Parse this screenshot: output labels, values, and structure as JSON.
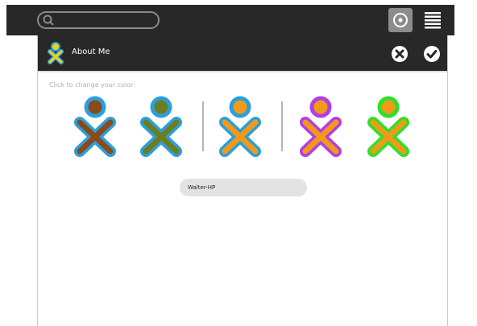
{
  "toolbar": {
    "search_placeholder": "",
    "icons": [
      "search-icon",
      "home-view-icon",
      "list-view-icon"
    ]
  },
  "dialog": {
    "title": "About Me",
    "prompt": "Click to change your color:",
    "icons": [
      "xo-icon",
      "cancel-icon",
      "ok-icon"
    ]
  },
  "color_choices": [
    {
      "head": "#8a4a1a",
      "body": "#8a4a1a",
      "stroke": "#2c9fdc"
    },
    {
      "head": "#6e7d1e",
      "body": "#6e7d1e",
      "stroke": "#2c9fdc"
    },
    {
      "head": "#f19a1a",
      "body": "#f19a1a",
      "stroke": "#2c9fdc"
    },
    {
      "head": "#f19a1a",
      "body": "#f19a1a",
      "stroke": "#b23ee6"
    },
    {
      "head": "#f19a1a",
      "body": "#f19a1a",
      "stroke": "#2ee02a"
    }
  ],
  "current_color_index": 2,
  "name": {
    "value": "Walter-HP"
  },
  "colors": {
    "toolbar_bg": "#282828",
    "dialog_bg": "#ffffff",
    "field_bg": "#e3e3e3"
  }
}
